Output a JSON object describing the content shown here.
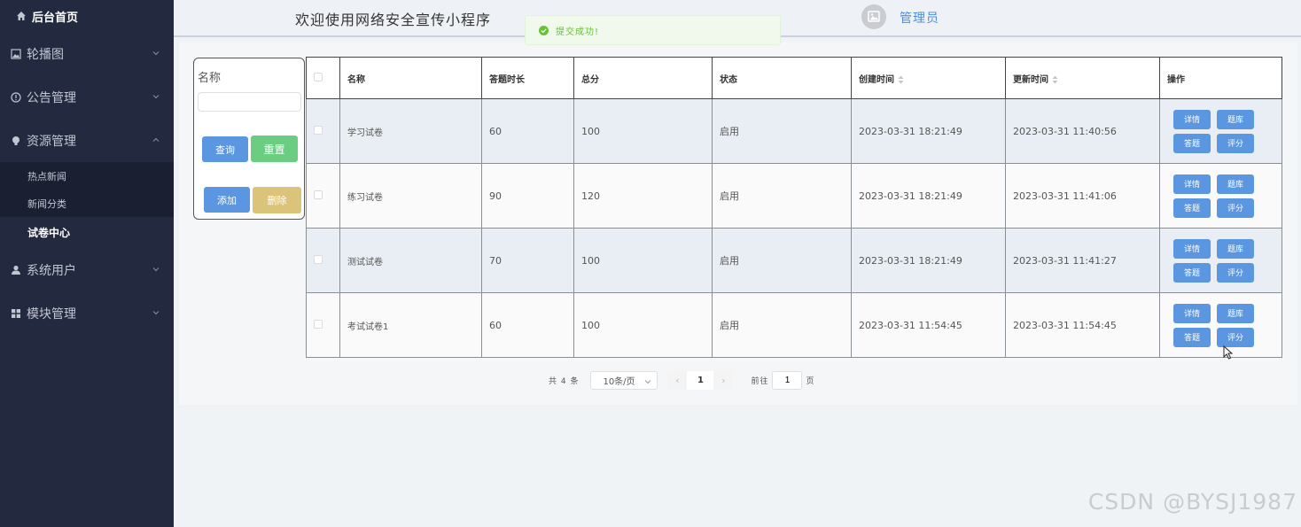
{
  "sidebar": {
    "home": "后台首页",
    "menus": [
      {
        "label": "轮播图",
        "icon": "image-icon"
      },
      {
        "label": "公告管理",
        "icon": "info-icon"
      },
      {
        "label": "资源管理",
        "icon": "bulb-icon"
      },
      {
        "label": "系统用户",
        "icon": "user-icon"
      },
      {
        "label": "模块管理",
        "icon": "grid-icon"
      }
    ],
    "subitems": [
      "热点新闻",
      "新闻分类",
      "试卷中心"
    ]
  },
  "header": {
    "title": "欢迎使用网络安全宣传小程序",
    "user": "管理员"
  },
  "toast": {
    "message": "提交成功!"
  },
  "search": {
    "label": "名称",
    "value": "",
    "query_btn": "查询",
    "reset_btn": "重置",
    "add_btn": "添加",
    "delete_btn": "删除"
  },
  "table": {
    "headers": [
      "名称",
      "答题时长",
      "总分",
      "状态",
      "创建时间",
      "更新时间",
      "操作"
    ],
    "rows": [
      {
        "name": "学习试卷",
        "duration": "60",
        "score": "100",
        "status": "启用",
        "created": "2023-03-31 18:21:49",
        "updated": "2023-03-31 11:40:56"
      },
      {
        "name": "练习试卷",
        "duration": "90",
        "score": "120",
        "status": "启用",
        "created": "2023-03-31 18:21:49",
        "updated": "2023-03-31 11:41:06"
      },
      {
        "name": "测试试卷",
        "duration": "70",
        "score": "100",
        "status": "启用",
        "created": "2023-03-31 18:21:49",
        "updated": "2023-03-31 11:41:27"
      },
      {
        "name": "考试试卷1",
        "duration": "60",
        "score": "100",
        "status": "启用",
        "created": "2023-03-31 11:54:45",
        "updated": "2023-03-31 11:54:45"
      }
    ],
    "ops": [
      "详情",
      "题库",
      "答题",
      "评分"
    ]
  },
  "pager": {
    "total": "共 4 条",
    "page_size": "10条/页",
    "current": "1",
    "goto_label": "前往",
    "goto_value": "1",
    "page_unit": "页"
  },
  "watermark": "CSDN @BYSJ1987",
  "colors": {
    "sidebar": "#23293e",
    "primary": "#5a97e0",
    "success": "#6acd82",
    "warning": "#dcc37a"
  }
}
